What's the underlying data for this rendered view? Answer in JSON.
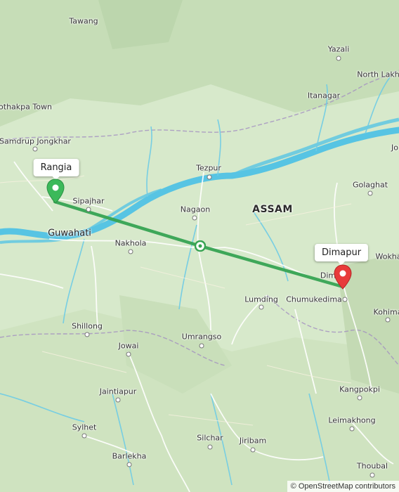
{
  "map": {
    "state_label": "ASSAM",
    "places": [
      {
        "name": "Tawang",
        "cls": "",
        "dot": false
      },
      {
        "name": "Yazali",
        "cls": "",
        "dot": true
      },
      {
        "name": "North Lakhi",
        "cls": "",
        "dot": false
      },
      {
        "name": "Itanagar",
        "cls": "",
        "dot": false
      },
      {
        "name": "othakpa Town",
        "cls": "",
        "dot": false
      },
      {
        "name": "Samdrup Jongkhar",
        "cls": "",
        "dot": true
      },
      {
        "name": "Tezpur",
        "cls": "",
        "dot": true
      },
      {
        "name": "Golaghat",
        "cls": "",
        "dot": true
      },
      {
        "name": "Sipajhar",
        "cls": "",
        "dot": true
      },
      {
        "name": "Nagaon",
        "cls": "",
        "dot": true
      },
      {
        "name": "Guwahati",
        "cls": "city",
        "dot": false
      },
      {
        "name": "Nakhola",
        "cls": "",
        "dot": true
      },
      {
        "name": "Wokha",
        "cls": "",
        "dot": false
      },
      {
        "name": "Dim",
        "cls": "",
        "dot": false
      },
      {
        "name": "Lumding",
        "cls": "",
        "dot": true
      },
      {
        "name": "Chumukedima",
        "cls": "",
        "dot": true
      },
      {
        "name": "Kohima",
        "cls": "",
        "dot": true
      },
      {
        "name": "Shillong",
        "cls": "",
        "dot": true
      },
      {
        "name": "Jowai",
        "cls": "",
        "dot": true
      },
      {
        "name": "Umrangso",
        "cls": "",
        "dot": true
      },
      {
        "name": "Jaintiapur",
        "cls": "",
        "dot": true
      },
      {
        "name": "Kangpokpi",
        "cls": "",
        "dot": true
      },
      {
        "name": "Leimakhong",
        "cls": "",
        "dot": true
      },
      {
        "name": "Sylhet",
        "cls": "",
        "dot": true
      },
      {
        "name": "Silchar",
        "cls": "",
        "dot": true
      },
      {
        "name": "Jiribam",
        "cls": "",
        "dot": true
      },
      {
        "name": "Barlekha",
        "cls": "",
        "dot": true
      },
      {
        "name": "Thoubal",
        "cls": "",
        "dot": true
      },
      {
        "name": "Jo",
        "cls": "",
        "dot": false
      }
    ],
    "route": {
      "origin": "Rangia",
      "destination": "Dimapur",
      "origin_color": "#3cb95a",
      "destination_color": "#e83b3b",
      "line_color": "#36a352"
    },
    "attribution": "© OpenStreetMap contributors",
    "colors": {
      "land": "#d5e8c9",
      "river": "#4fc3e0",
      "road": "#ffffff",
      "border": "#9a8fb5"
    }
  }
}
